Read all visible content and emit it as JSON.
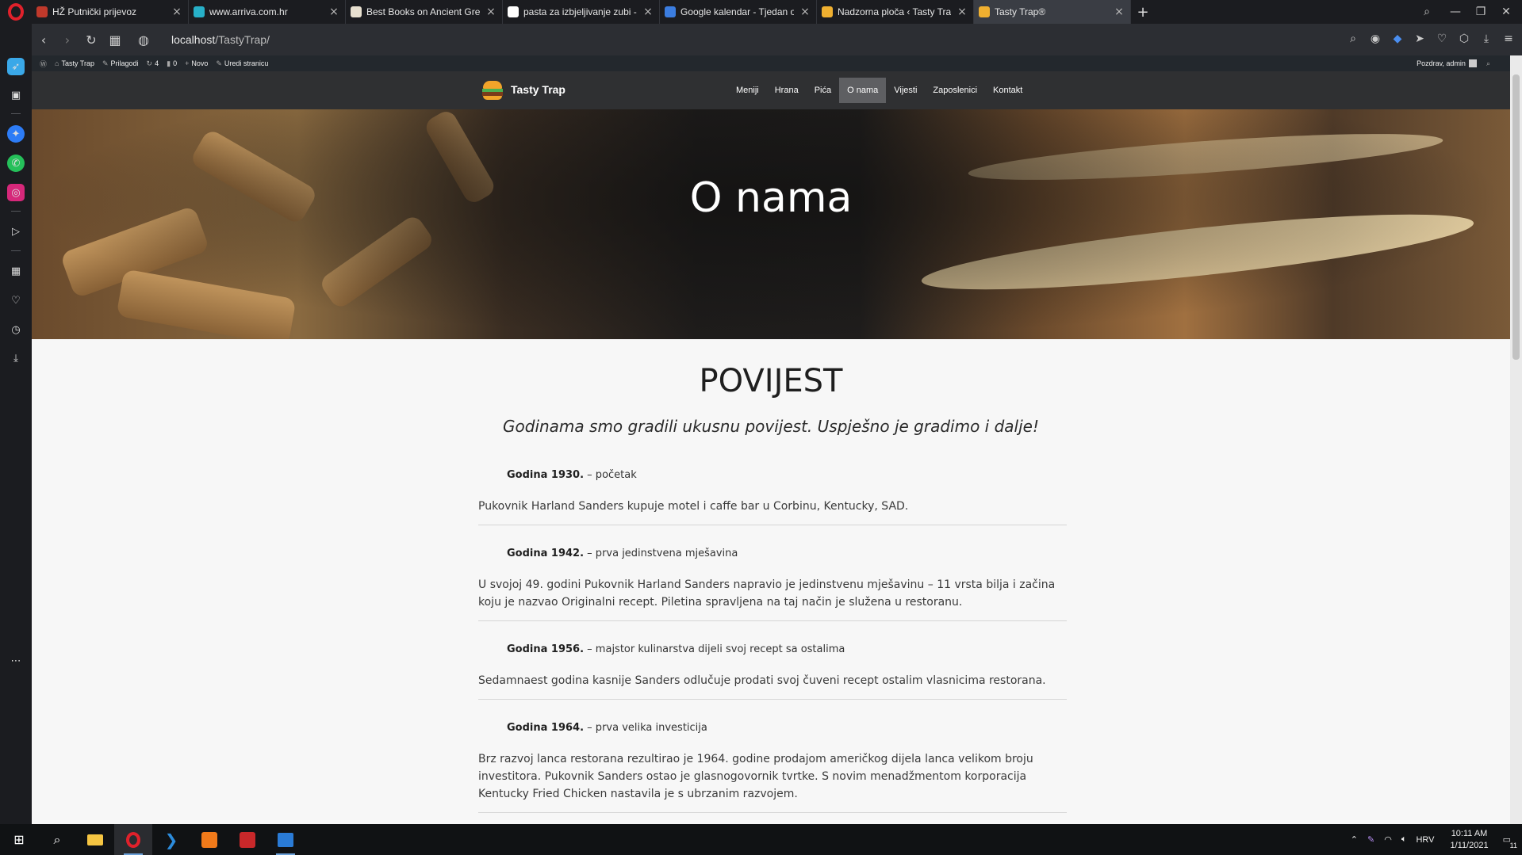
{
  "browser": {
    "tabs": [
      {
        "title": "HŽ Putnički prijevoz",
        "favicon_color": "#c0392b",
        "active": false
      },
      {
        "title": "www.arriva.com.hr",
        "favicon_color": "#27b0c8",
        "active": false
      },
      {
        "title": "Best Books on Ancient Gre",
        "favicon_color": "#e8e0d0",
        "active": false
      },
      {
        "title": "pasta za izbjeljivanje zubi -",
        "favicon_color": "#ffffff",
        "active": false
      },
      {
        "title": "Google kalendar - Tjedan o",
        "favicon_color": "#3b7de0",
        "active": false
      },
      {
        "title": "Nadzorna ploča ‹ Tasty Trap",
        "favicon_color": "#f0b030",
        "active": false
      },
      {
        "title": "Tasty Trap®",
        "favicon_color": "#f0b030",
        "active": true
      }
    ],
    "new_tab_symbol": "+",
    "url_host": "localhost",
    "url_path": "/TastyTrap/"
  },
  "wp_admin_bar": {
    "site_name": "Tasty Trap",
    "customize": "Prilagodi",
    "updates_count": "4",
    "comments_count": "0",
    "new_label": "Novo",
    "edit_label": "Uredi stranicu",
    "greeting": "Pozdrav, admin"
  },
  "site": {
    "logo_text": "Tasty Trap",
    "nav": [
      {
        "label": "Meniji",
        "active": false
      },
      {
        "label": "Hrana",
        "active": false
      },
      {
        "label": "Pića",
        "active": false
      },
      {
        "label": "O nama",
        "active": true
      },
      {
        "label": "Vijesti",
        "active": false
      },
      {
        "label": "Zaposlenici",
        "active": false
      },
      {
        "label": "Kontakt",
        "active": false
      }
    ],
    "hero_title": "O nama",
    "section_title": "POVIJEST",
    "section_subtitle": "Godinama smo gradili ukusnu povijest. Uspješno je gradimo i dalje!",
    "timeline": [
      {
        "year": "Godina 1930.",
        "caption": " – početak",
        "text": "Pukovnik Harland Sanders kupuje motel i caffe bar u Corbinu, Kentucky, SAD."
      },
      {
        "year": "Godina 1942.",
        "caption": " – prva jedinstvena mješavina",
        "text": "U svojoj 49. godini Pukovnik Harland Sanders napravio je jedinstvenu mješavinu – 11 vrsta bilja i začina koju je nazvao Originalni recept. Piletina spravljena na taj način je služena u restoranu."
      },
      {
        "year": "Godina 1956.",
        "caption": " – majstor kulinarstva dijeli svoj recept sa ostalima",
        "text": "Sedamnaest godina kasnije Sanders odlučuje prodati svoj čuveni recept ostalim vlasnicima restorana."
      },
      {
        "year": "Godina 1964.",
        "caption": " – prva velika investicija",
        "text": "Brz razvoj lanca restorana rezultirao je 1964. godine prodajom američkog dijela lanca velikom broju investitora. Pukovnik Sanders ostao je glasnogovornik tvrtke. S novim menadžmentom korporacija Kentucky Fried Chicken nastavila je s ubrzanim razvojem."
      }
    ]
  },
  "taskbar": {
    "language": "HRV",
    "time": "10:11 AM",
    "date": "1/11/2021",
    "notification_count": "11"
  }
}
